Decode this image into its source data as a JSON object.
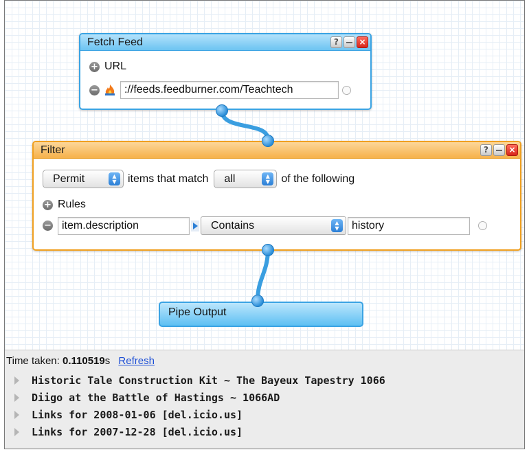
{
  "fetch_feed": {
    "title": "Fetch Feed",
    "url_label": "URL",
    "url_value": "://feeds.feedburner.com/Teachtech"
  },
  "filter": {
    "title": "Filter",
    "mode": "Permit",
    "items_that_match": "items that match",
    "match": "all",
    "of_the_following": "of the following",
    "rules_label": "Rules",
    "rule_field": "item.description",
    "rule_operator": "Contains",
    "rule_value": "history"
  },
  "pipe_output": {
    "title": "Pipe Output"
  },
  "titlebar_buttons": {
    "help": "?",
    "close": "×"
  },
  "results": {
    "time_label": "Time taken:",
    "time_value": "0.110519",
    "time_unit": "s",
    "refresh": "Refresh",
    "items": [
      "Historic Tale Construction Kit ~ The Bayeux Tapestry 1066",
      "Diigo at the Battle of Hastings ~ 1066AD",
      "Links for 2008-01-06 [del.icio.us]",
      "Links for 2007-12-28 [del.icio.us]"
    ]
  },
  "icons": [
    "plus-icon",
    "minus-icon",
    "feed-flame-icon",
    "help-icon",
    "minimize-icon",
    "close-icon",
    "expand-triangle-icon"
  ],
  "colors": {
    "module_blue": "#3aa3e3",
    "module_orange": "#f0a020",
    "wire": "#3a9ee0",
    "link": "#1d4fd6"
  }
}
